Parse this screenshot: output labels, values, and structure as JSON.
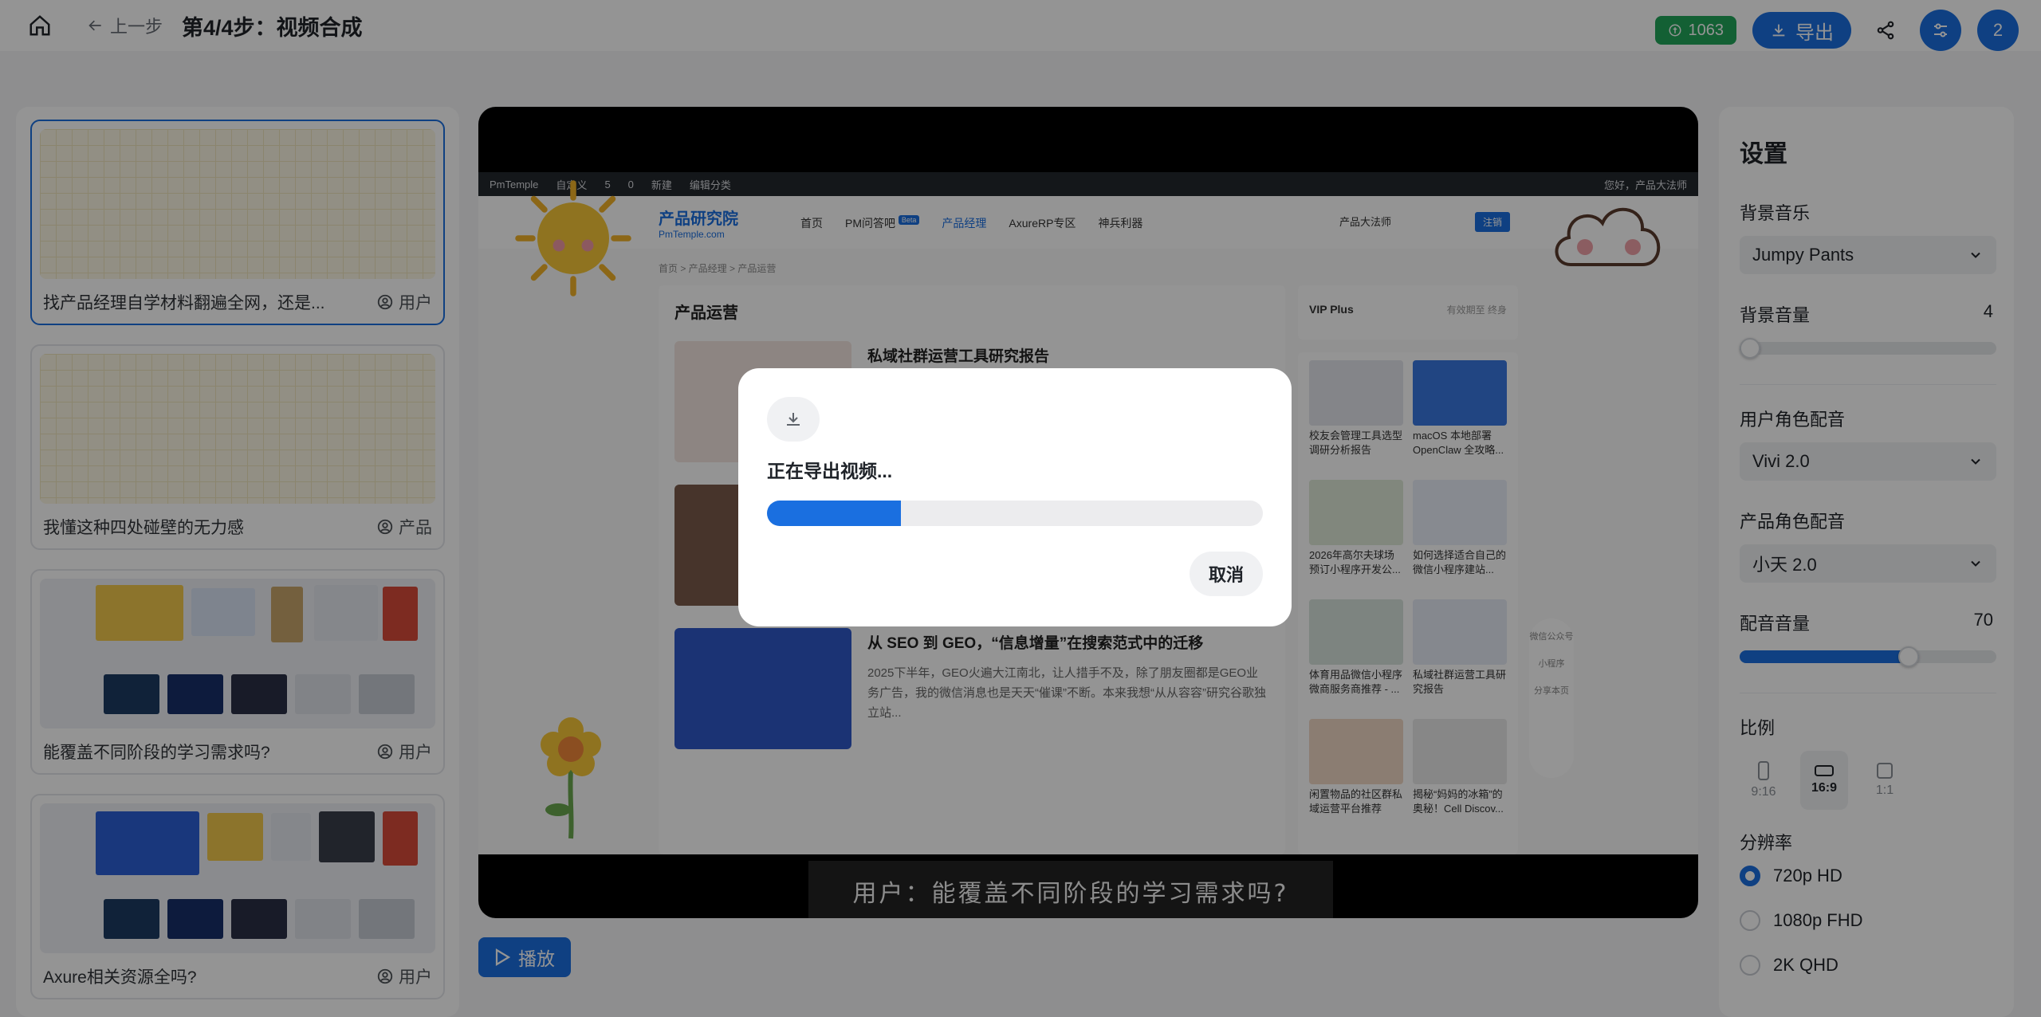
{
  "header": {
    "back_label": "上一步",
    "title": "第4/4步：视频合成",
    "credits": "1063",
    "export_label": "导出",
    "user_badge": "2"
  },
  "scenes": [
    {
      "caption": "找产品经理自学材料翻遍全网，还是...",
      "role": "用户",
      "active": true
    },
    {
      "caption": "我懂这种四处碰壁的无力感",
      "role": "产品",
      "active": false
    },
    {
      "caption": "能覆盖不同阶段的学习需求吗?",
      "role": "用户",
      "active": false
    },
    {
      "caption": "Axure相关资源全吗?",
      "role": "用户",
      "active": false
    }
  ],
  "preview": {
    "wp_bar": [
      "PmTemple",
      "自定义",
      "5",
      "0",
      "新建",
      "编辑分类"
    ],
    "wp_greeting": "您好，产品大法师",
    "logo": "产品研究院",
    "logo_sub": "PmTemple.com",
    "nav": [
      "首页",
      "PM问答吧",
      "产品经理",
      "AxureRP专区",
      "神兵利器"
    ],
    "nav_badge": "Beta",
    "nav_user": "产品大法师",
    "nav_login": "注销",
    "breadcrumb": "首页 > 产品经理 > 产品运营",
    "section_title": "产品运营",
    "articles": [
      {
        "title": "私域社群运营工具研究报告",
        "desc": ""
      },
      {
        "title": "",
        "desc": ""
      },
      {
        "title": "从 SEO 到 GEO，“信息增量”在搜索范式中的迁移",
        "desc": "2025下半年，GEO火遍大江南北，让人措手不及，除了朋友圈都是GEO业务广告，我的微信消息也是天天“催课”不断。本来我想“从从容容”研究谷歌独立站..."
      }
    ],
    "vip_label": "VIP Plus",
    "vip_status": "有效期至 终身",
    "side_items": [
      "校友会管理工具选型调研分析报告",
      "macOS 本地部署 OpenClaw 全攻略...",
      "2026年高尔夫球场预订小程序开发公...",
      "如何选择适合自己的微信小程序建站...",
      "体育用品微信小程序微商服务商推荐 - ...",
      "私域社群运营工具研究报告",
      "闲置物品的社区群私域运营平台推荐",
      "揭秘“妈妈的冰箱”的奥秘！Cell Discov..."
    ],
    "float_tools": [
      "微信公众号",
      "小程序",
      "分享本页"
    ],
    "subtitle": "用户：能覆盖不同阶段的学习需求吗?"
  },
  "play_label": "播放",
  "settings": {
    "title": "设置",
    "bgm_label": "背景音乐",
    "bgm_value": "Jumpy Pants",
    "bgm_volume_label": "背景音量",
    "bgm_volume": "4",
    "bgm_volume_pct": 4,
    "user_voice_label": "用户角色配音",
    "user_voice_value": "Vivi 2.0",
    "product_voice_label": "产品角色配音",
    "product_voice_value": "小天 2.0",
    "voice_volume_label": "配音音量",
    "voice_volume": "70",
    "voice_volume_pct": 70,
    "ratio_label": "比例",
    "ratios": [
      {
        "label": "9:16",
        "selected": false
      },
      {
        "label": "16:9",
        "selected": true
      },
      {
        "label": "1:1",
        "selected": false
      }
    ],
    "resolution_label": "分辨率",
    "resolutions": [
      {
        "label": "720p HD",
        "selected": true
      },
      {
        "label": "1080p FHD",
        "selected": false
      },
      {
        "label": "2K QHD",
        "selected": false
      }
    ]
  },
  "modal": {
    "text": "正在导出视频...",
    "progress_pct": 27,
    "cancel_label": "取消"
  },
  "colors": {
    "accent": "#1a6fe0",
    "credits_green": "#22a55a"
  }
}
